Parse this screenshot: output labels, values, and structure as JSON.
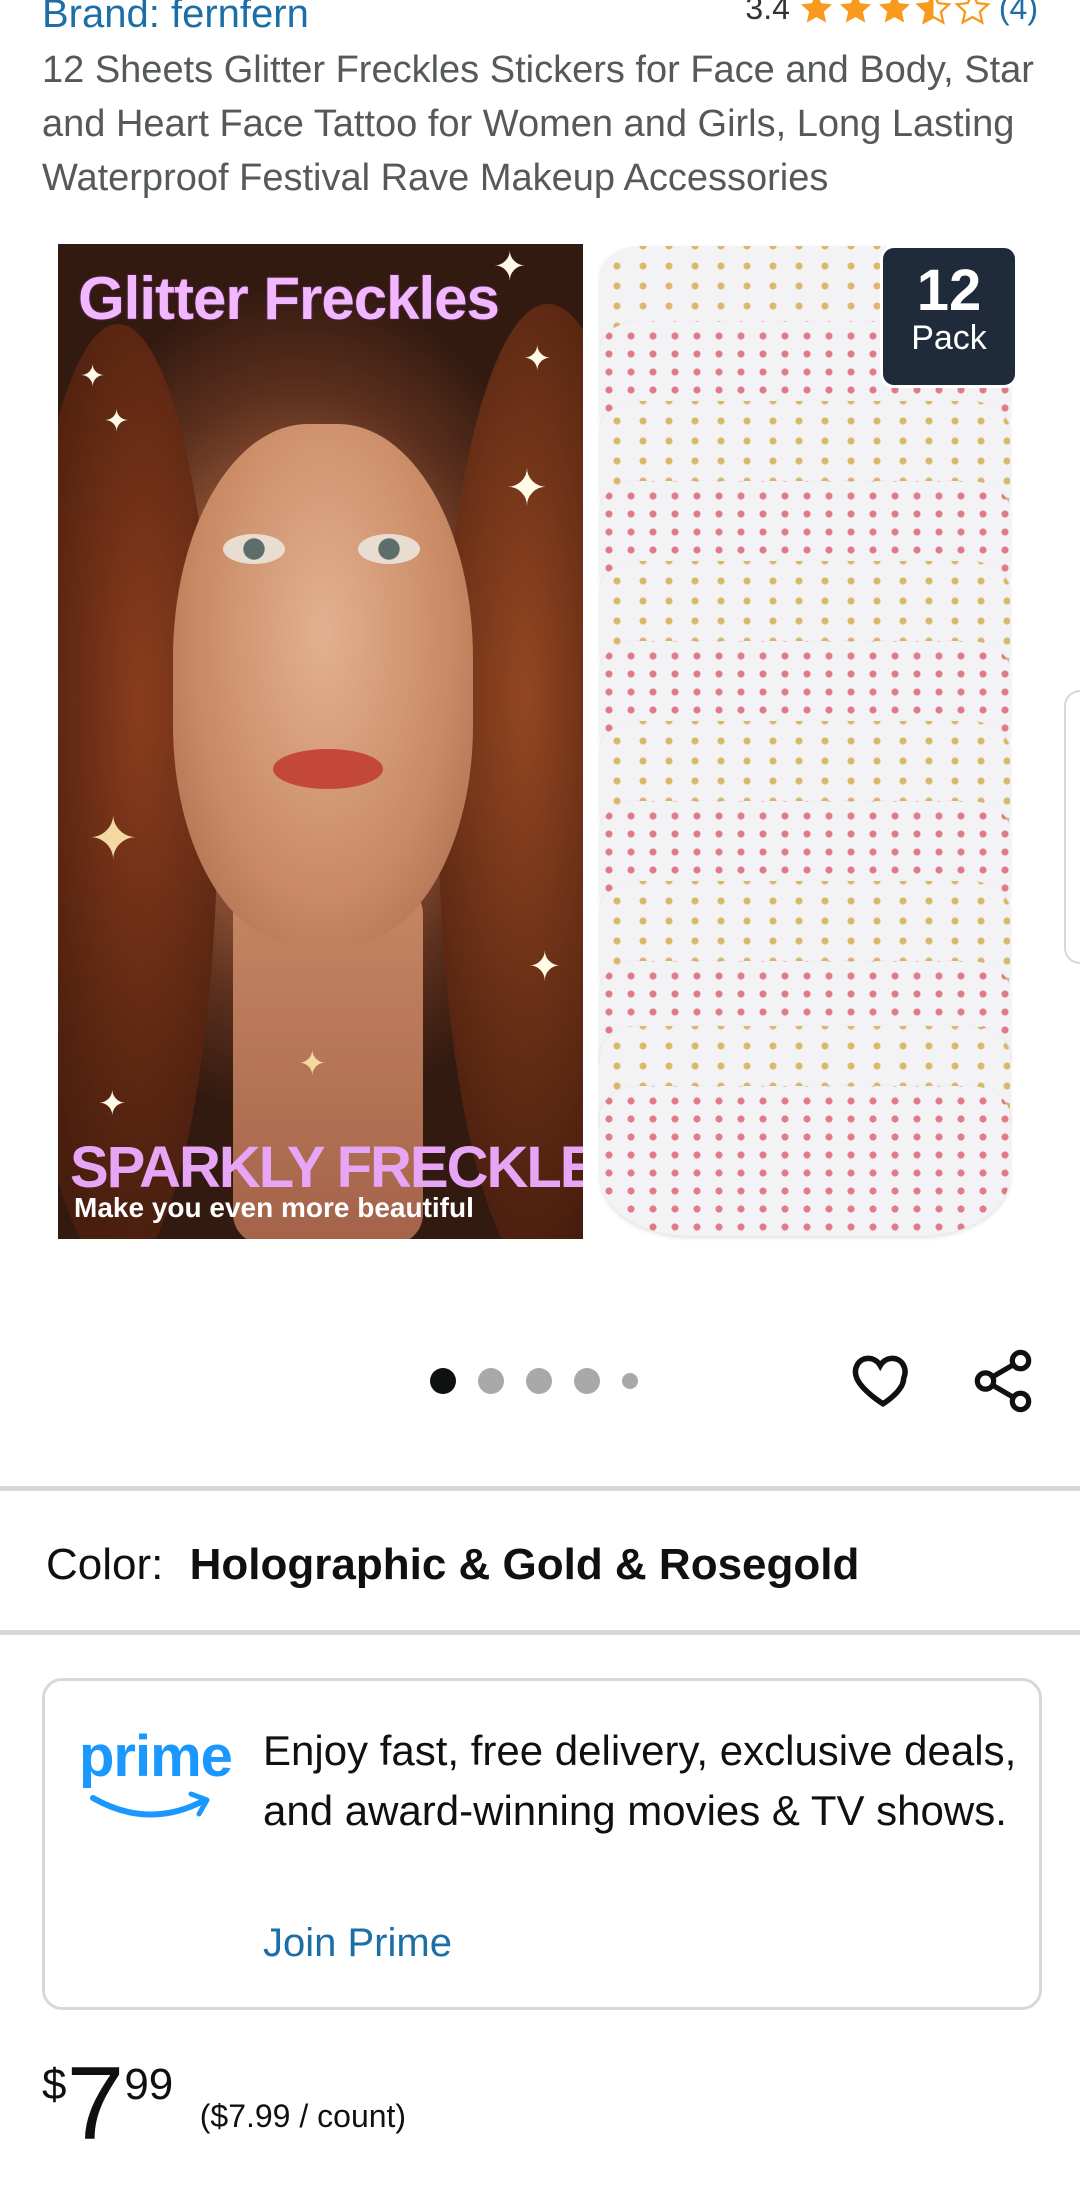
{
  "header": {
    "brand": "Brand: fernfern",
    "rating_value": "3.4",
    "rating_stars": 3.4,
    "rating_count": "(4)",
    "title": "12 Sheets Glitter Freckles Stickers for Face and Body, Star and Heart Face Tattoo for Women and Girls, Long Lasting Waterproof Festival Rave Makeup Accessories"
  },
  "image": {
    "hero_title": "Glitter Freckles",
    "hero_subtitle": "SPARKLY FRECKLES",
    "hero_tagline": "Make you even more beautiful",
    "pack_number": "12",
    "pack_label": "Pack"
  },
  "carousel": {
    "total_dots": 5,
    "active_index": 0
  },
  "icons": {
    "wishlist": "heart-outline-icon",
    "share": "share-icon"
  },
  "color": {
    "label": "Color:",
    "value": "Holographic & Gold & Rosegold"
  },
  "prime": {
    "logo": "prime",
    "text": "Enjoy fast, free delivery, exclusive deals, and award-winning movies & TV shows.",
    "link": "Join Prime"
  },
  "price": {
    "symbol": "$",
    "whole": "7",
    "fraction": "99",
    "per_unit": "($7.99 / count)"
  },
  "colors": {
    "link": "#1c6fa6",
    "star": "#f79a1e",
    "prime_blue": "#1a98ff"
  }
}
